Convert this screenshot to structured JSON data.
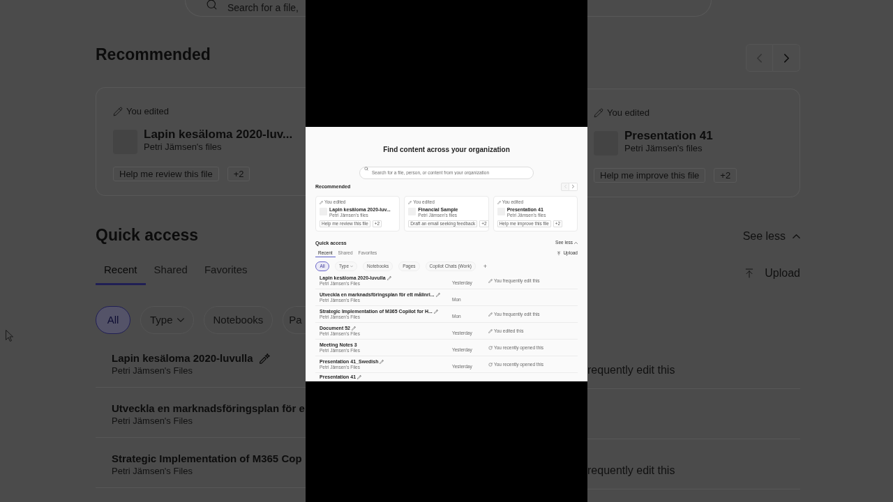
{
  "backdrop_left": {
    "search": {
      "placeholder": "Search for a file,"
    },
    "recommended": {
      "title": "Recommended",
      "card": {
        "activity": "You edited",
        "title": "Lapin kesäloma 2020-luv...",
        "owner": "Petri Jämsen's files",
        "chips": [
          "Help me review this file",
          "+2"
        ]
      }
    },
    "quick_access": {
      "title": "Quick access",
      "tabs": [
        {
          "label": "Recent",
          "selected": true
        },
        {
          "label": "Shared",
          "selected": false
        },
        {
          "label": "Favorites",
          "selected": false
        }
      ],
      "filters": [
        {
          "kind": "chip",
          "label": "All",
          "selected": true
        },
        {
          "kind": "dropdown",
          "label": "Type",
          "selected": false
        },
        {
          "kind": "chip",
          "label": "Notebooks",
          "selected": false
        },
        {
          "kind": "chip",
          "label": "Pa",
          "selected": false
        }
      ],
      "rows": [
        {
          "name": "Lapin kesäloma 2020-luvulla",
          "edit_icon": true,
          "owner": "Petri Jämsen's Files"
        },
        {
          "name": "Utveckla en marknadsföringsplan för e",
          "edit_icon": false,
          "owner": "Petri Jämsen's Files"
        },
        {
          "name": "Strategic Implementation of M365 Cop",
          "edit_icon": false,
          "owner": "Petri Jämsen's Files"
        }
      ]
    }
  },
  "center_view": {
    "heading": "Find content across your organization",
    "search": {
      "placeholder": "Search for a file, person, or content from your organization"
    },
    "recommended": {
      "title": "Recommended",
      "pager": {
        "previous_disabled": true,
        "next_disabled": false
      },
      "cards": [
        {
          "activity": "You edited",
          "title": "Lapin kesäloma 2020-luv...",
          "owner": "Petri Jämsen's files",
          "chips": [
            "Help me review this file",
            "+2"
          ]
        },
        {
          "activity": "You edited",
          "title": "Financial Sample",
          "owner": "Petri Jämsen's files",
          "chips": [
            "Draft an email seeking feedback",
            "+2"
          ]
        },
        {
          "activity": "You edited",
          "title": "Presentation 41",
          "owner": "Petri Jämsen's files",
          "chips": [
            "Help me improve this file",
            "+2"
          ]
        }
      ]
    },
    "quick_access": {
      "title": "Quick access",
      "see_less": "See less",
      "tabs": [
        {
          "label": "Recent",
          "selected": true
        },
        {
          "label": "Shared",
          "selected": false
        },
        {
          "label": "Favorites",
          "selected": false
        }
      ],
      "upload": "Upload",
      "filters": [
        {
          "kind": "chip",
          "label": "All",
          "selected": true
        },
        {
          "kind": "dropdown",
          "label": "Type",
          "selected": false
        },
        {
          "kind": "chip",
          "label": "Notebooks",
          "selected": false
        },
        {
          "kind": "chip",
          "label": "Pages",
          "selected": false
        },
        {
          "kind": "chip",
          "label": "Copilot Chats (Work)",
          "selected": false
        },
        {
          "kind": "add",
          "label": "+",
          "selected": false
        }
      ],
      "rows": [
        {
          "name": "Lapin kesäloma 2020-luvulla",
          "edit_icon": true,
          "owner": "Petri Jämsen's Files",
          "date": "Yesterday",
          "activity": {
            "kind": "edit",
            "text": "You frequently edit this"
          }
        },
        {
          "name": "Utveckla en marknadsföringsplan för ett målinri...",
          "edit_icon": true,
          "owner": "Petri Jämsen's Files",
          "date": "Mon"
        },
        {
          "name": "Strategic Implementation of M365 Copilot for H...",
          "edit_icon": true,
          "owner": "Petri Jämsen's Files",
          "date": "Mon",
          "activity": {
            "kind": "edit",
            "text": "You frequently edit this"
          }
        },
        {
          "name": "Document 52",
          "edit_icon": true,
          "owner": "Petri Jämsen's Files",
          "date": "Yesterday",
          "activity": {
            "kind": "edit",
            "text": "You edited this"
          }
        },
        {
          "name": "Meeting Notes 3",
          "edit_icon": false,
          "owner": "Petri Jämsen's Files",
          "date": "Yesterday",
          "activity": {
            "kind": "open",
            "text": "You recently opened this"
          }
        },
        {
          "name": "Presentation 41_Swedish",
          "edit_icon": true,
          "owner": "Petri Jämsen's Files",
          "date": "Yesterday",
          "activity": {
            "kind": "open",
            "text": "You recently opened this"
          }
        },
        {
          "name": "Presentation 41",
          "edit_icon": true
        }
      ]
    }
  },
  "backdrop_right": {
    "pager": {
      "previous_disabled": true,
      "next_disabled": false
    },
    "card": {
      "activity": "You edited",
      "title": "Presentation 41",
      "owner": "Petri Jämsen's files",
      "chips": [
        "Help me improve this file",
        "+2"
      ]
    },
    "see_less": "See less",
    "upload": "Upload",
    "rows": [
      {
        "kind": "text",
        "activity": "requently edit this"
      },
      {
        "kind": "blank"
      },
      {
        "kind": "text",
        "activity": "requently edit this"
      }
    ]
  }
}
